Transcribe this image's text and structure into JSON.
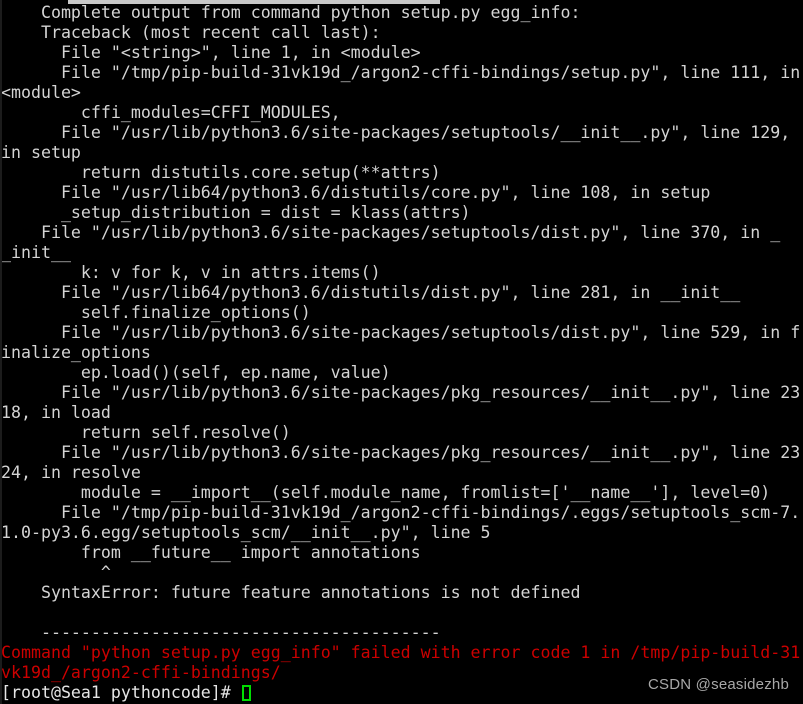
{
  "terminal": {
    "title": "root@Sea1:~/pythoncode",
    "colors": {
      "background": "#000000",
      "foreground": "#d4d4d4",
      "error_red": "#cc0000",
      "cursor_green": "#00dd00",
      "watermark_gray": "#a8a8a8",
      "selection_gray": "#c8c8c8"
    },
    "font_size_px": 16.6,
    "line_height_px": 20,
    "columns": 80,
    "rows": 35
  },
  "output_lines": [
    {
      "text": "    Complete output from command python setup.py egg_info:",
      "color": "default"
    },
    {
      "text": "    Traceback (most recent call last):",
      "color": "default"
    },
    {
      "text": "      File \"<string>\", line 1, in <module>",
      "color": "default"
    },
    {
      "text": "      File \"/tmp/pip-build-31vk19d_/argon2-cffi-bindings/setup.py\", line 111, in",
      "color": "default"
    },
    {
      "text": "<module>",
      "color": "default"
    },
    {
      "text": "        cffi_modules=CFFI_MODULES,",
      "color": "default"
    },
    {
      "text": "      File \"/usr/lib/python3.6/site-packages/setuptools/__init__.py\", line 129,",
      "color": "default"
    },
    {
      "text": "in setup",
      "color": "default"
    },
    {
      "text": "        return distutils.core.setup(**attrs)",
      "color": "default"
    },
    {
      "text": "      File \"/usr/lib64/python3.6/distutils/core.py\", line 108, in setup",
      "color": "default"
    },
    {
      "text": "      _setup_distribution = dist = klass(attrs)",
      "color": "default"
    },
    {
      "text": "    File \"/usr/lib/python3.6/site-packages/setuptools/dist.py\", line 370, in _",
      "color": "default"
    },
    {
      "text": "_init__",
      "color": "default"
    },
    {
      "text": "        k: v for k, v in attrs.items()",
      "color": "default"
    },
    {
      "text": "      File \"/usr/lib64/python3.6/distutils/dist.py\", line 281, in __init__",
      "color": "default"
    },
    {
      "text": "        self.finalize_options()",
      "color": "default"
    },
    {
      "text": "      File \"/usr/lib/python3.6/site-packages/setuptools/dist.py\", line 529, in f",
      "color": "default"
    },
    {
      "text": "inalize_options",
      "color": "default"
    },
    {
      "text": "        ep.load()(self, ep.name, value)",
      "color": "default"
    },
    {
      "text": "      File \"/usr/lib/python3.6/site-packages/pkg_resources/__init__.py\", line 23",
      "color": "default"
    },
    {
      "text": "18, in load",
      "color": "default"
    },
    {
      "text": "        return self.resolve()",
      "color": "default"
    },
    {
      "text": "      File \"/usr/lib/python3.6/site-packages/pkg_resources/__init__.py\", line 23",
      "color": "default"
    },
    {
      "text": "24, in resolve",
      "color": "default"
    },
    {
      "text": "        module = __import__(self.module_name, fromlist=['__name__'], level=0)",
      "color": "default"
    },
    {
      "text": "      File \"/tmp/pip-build-31vk19d_/argon2-cffi-bindings/.eggs/setuptools_scm-7.",
      "color": "default"
    },
    {
      "text": "1.0-py3.6.egg/setuptools_scm/__init__.py\", line 5",
      "color": "default"
    },
    {
      "text": "        from __future__ import annotations",
      "color": "default"
    },
    {
      "text": "          ^",
      "color": "default"
    },
    {
      "text": "    SyntaxError: future feature annotations is not defined",
      "color": "default"
    },
    {
      "text": "",
      "color": "default"
    },
    {
      "text": "    ----------------------------------------",
      "color": "default"
    },
    {
      "text": "Command \"python setup.py egg_info\" failed with error code 1 in /tmp/pip-build-31",
      "color": "red"
    },
    {
      "text": "vk19d_/argon2-cffi-bindings/",
      "color": "red"
    }
  ],
  "prompt": {
    "user": "root",
    "host": "Sea1",
    "cwd": "pythoncode",
    "text": "[root@Sea1 pythoncode]# ",
    "cursor": "block-outline"
  },
  "watermark": {
    "text": "CSDN @seasidezhb"
  }
}
